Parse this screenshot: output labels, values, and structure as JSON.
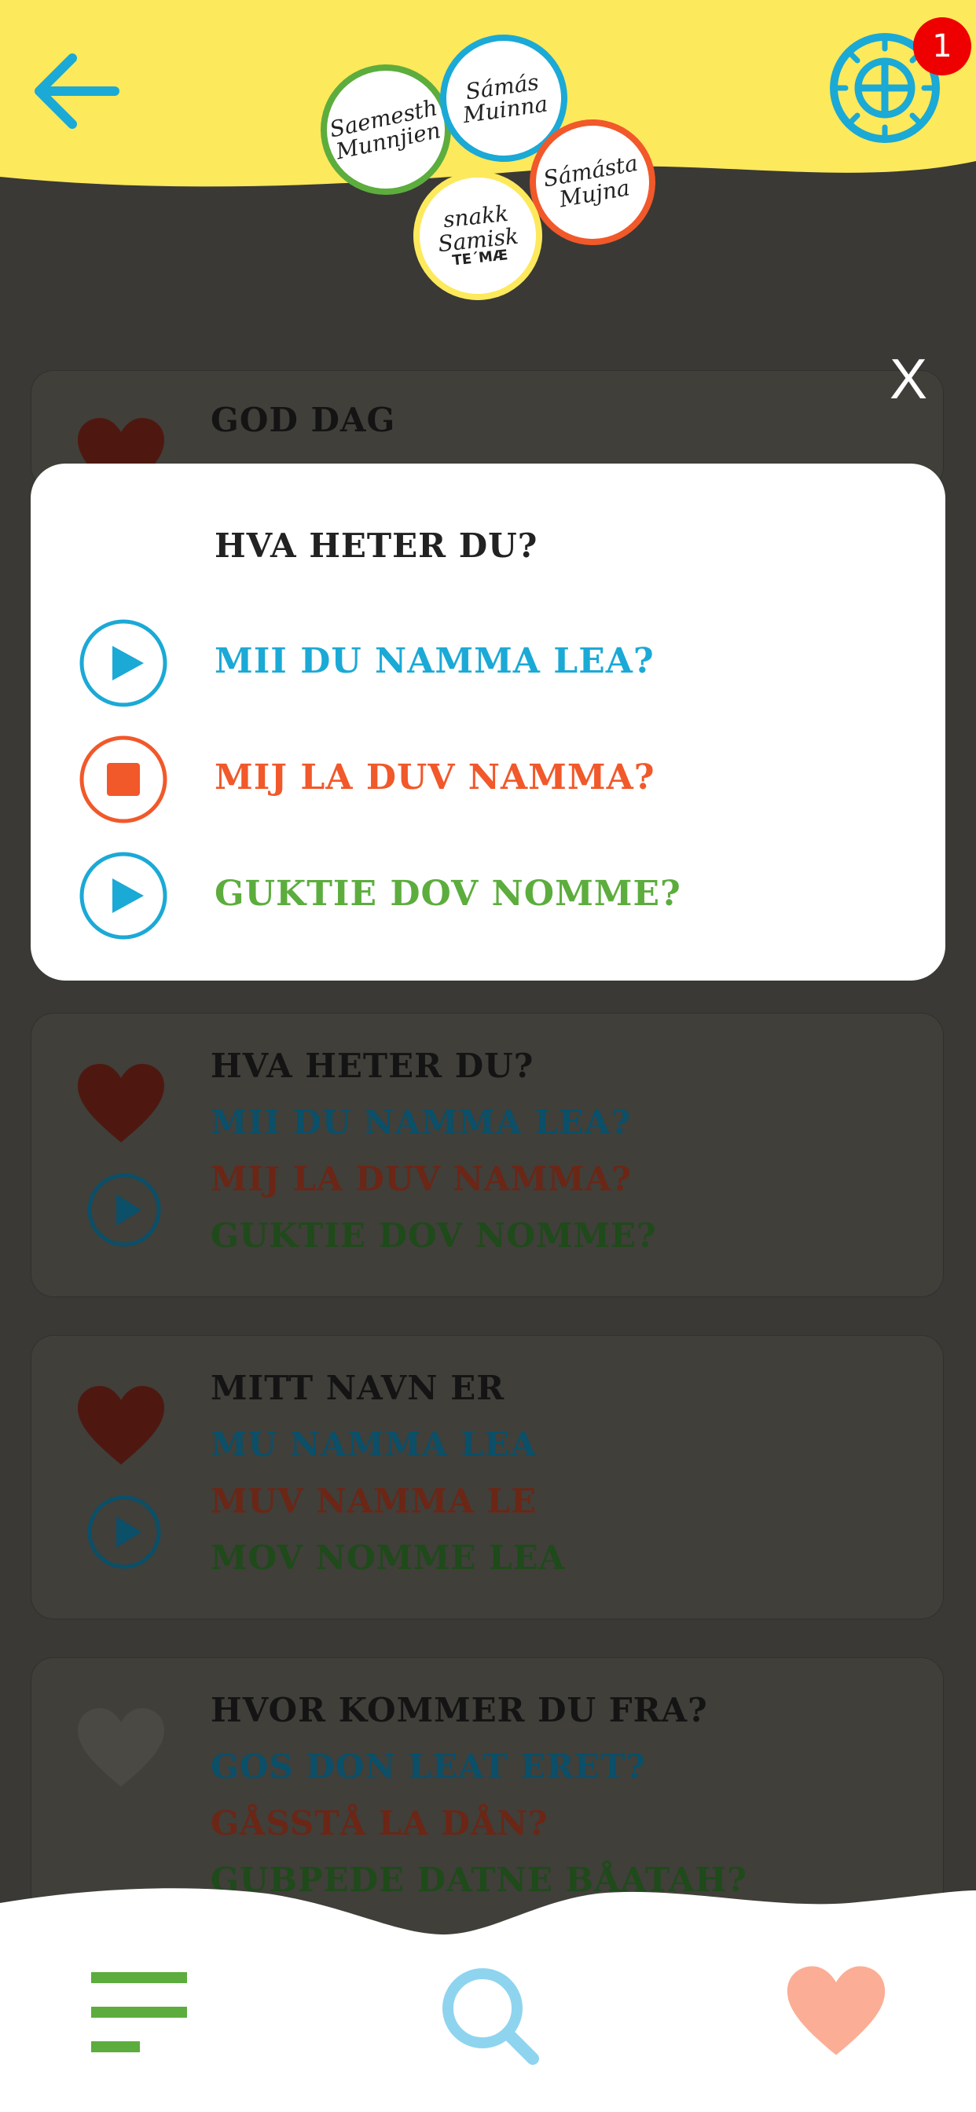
{
  "header": {
    "notification_count": "1",
    "logo": {
      "south": "Saemesth Munnjien",
      "lule": "Sámás Muinna",
      "north": "Sámásta Mujna",
      "norwegian": "snakk Samisk",
      "norwegian_sub": "TE´MÆ"
    }
  },
  "close_label": "X",
  "modal": {
    "title": "HVA HETER DU?",
    "rows": [
      {
        "text": "MII DU NAMMA LEA?",
        "state": "play"
      },
      {
        "text": "MIJ LA DUV NAMMA?",
        "state": "stop"
      },
      {
        "text": "GUKTIE DOV NOMME?",
        "state": "play"
      }
    ]
  },
  "phrases": [
    {
      "title": "GOD DAG",
      "lines": []
    },
    {
      "title": "HVA HETER DU?",
      "lines": [
        "MII DU NAMMA LEA?",
        "MIJ LA DUV NAMMA?",
        "GUKTIE DOV NOMME?"
      ]
    },
    {
      "title": "MITT NAVN ER",
      "lines": [
        "MU NAMMA LEA",
        "MUV NAMMA LE",
        "MOV NOMME LEA"
      ]
    },
    {
      "title": "HVOR KOMMER DU FRA?",
      "lines": [
        "GOS DON LEAT ERET?",
        "GÅSSTÅ LA DÅN?",
        "GUBPEDE DATNE BÅATAH?"
      ]
    }
  ],
  "colors": {
    "header_yellow": "#fde95c",
    "accent_blue": "#1ba9d6",
    "accent_orange": "#f1582a",
    "accent_green": "#5cad3d",
    "favorite_heart": "#fbae95",
    "search_blue": "#8fd4ef"
  },
  "icons": [
    "back-arrow-icon",
    "sun-icon",
    "heart-icon",
    "play-icon",
    "stop-icon",
    "menu-icon",
    "search-icon"
  ]
}
